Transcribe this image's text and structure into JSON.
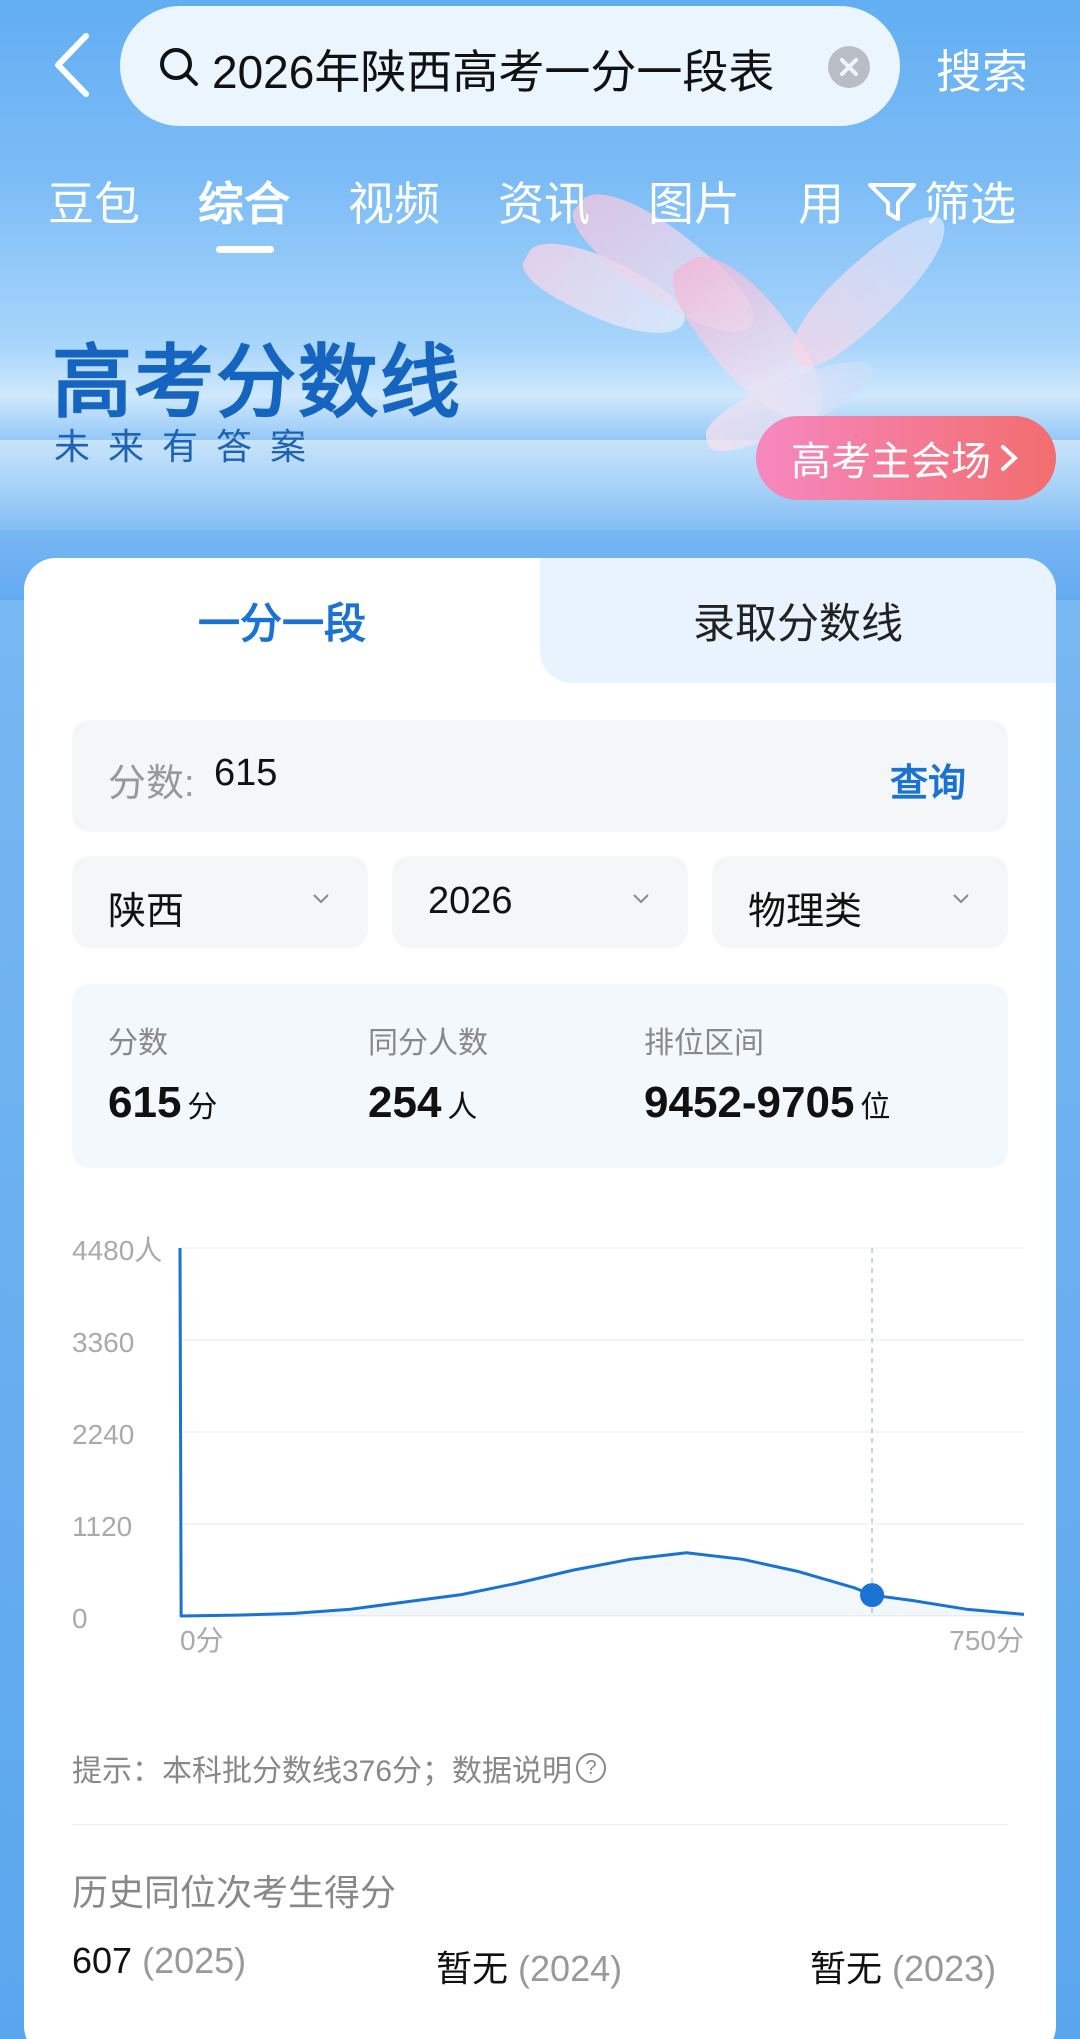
{
  "search": {
    "query": "2026年陕西高考一分一段表",
    "button": "搜索"
  },
  "tabs": [
    "豆包",
    "综合",
    "视频",
    "资讯",
    "图片",
    "用"
  ],
  "filter_label": "筛选",
  "hero": {
    "title": "高考分数线",
    "subtitle": "未来有答案",
    "venue_button": "高考主会场"
  },
  "card": {
    "tab_1": "一分一段",
    "tab_2": "录取分数线",
    "score_label": "分数:",
    "score_value": "615",
    "query_button": "查询",
    "selects": [
      "陕西",
      "2026",
      "物理类"
    ],
    "stats": [
      {
        "label": "分数",
        "value": "615",
        "unit": "分"
      },
      {
        "label": "同分人数",
        "value": "254",
        "unit": "人"
      },
      {
        "label": "排位区间",
        "value": "9452-9705",
        "unit": "位"
      }
    ],
    "tip": "提示：本科批分数线376分；数据说明",
    "history_title": "历史同位次考生得分",
    "history": [
      {
        "score": "607",
        "year": "(2025)"
      },
      {
        "score": "暂无",
        "year": "(2024)"
      },
      {
        "score": "暂无",
        "year": "(2023)"
      }
    ]
  },
  "colors": {
    "accent": "#1a73d4",
    "line": "#1a73d4"
  },
  "chart_data": {
    "type": "line",
    "x_tick_labels": [
      "0分",
      "750分"
    ],
    "y_tick_labels": [
      "4480人",
      "3360",
      "2240",
      "1120",
      "0"
    ],
    "ylim": [
      0,
      4480
    ],
    "xlim": [
      0,
      750
    ],
    "series": [
      {
        "x": [
          0,
          1,
          50,
          100,
          150,
          200,
          250,
          300,
          350,
          400,
          450,
          500,
          550,
          600,
          615,
          650,
          700,
          750
        ],
        "values": [
          4480,
          0,
          10,
          30,
          80,
          170,
          260,
          400,
          560,
          690,
          770,
          690,
          540,
          340,
          254,
          190,
          80,
          20
        ]
      }
    ],
    "highlight": {
      "x": 615,
      "y": 254
    }
  }
}
